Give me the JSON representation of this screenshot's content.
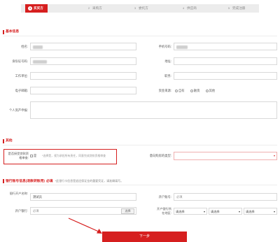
{
  "steps": [
    {
      "num": "1",
      "label": "买买方"
    },
    {
      "num": "2",
      "label": "采购方"
    },
    {
      "num": "3",
      "label": "委托方"
    },
    {
      "num": "4",
      "label": "供应商"
    },
    {
      "num": "5",
      "label": "完成注册"
    }
  ],
  "basic": {
    "title": "基本信息",
    "name_label": "姓名:",
    "phone_label": "手机号码:",
    "idcard_label": "身份证号码:",
    "address_label": "地址:",
    "workplace_label": "工作单位:",
    "position_label": "职务:",
    "email_label": "电子邮箱:",
    "funds_label": "资金来源:",
    "funds_options": [
      "自有",
      "融资",
      "其他"
    ],
    "assets_label": "个人资产申报:"
  },
  "other": {
    "title": "其他",
    "qualification_label": "是否接受贷款资格审查:",
    "checkbox_label": "是",
    "hint": "*选择是，视为承担所有责任，同意完成贷款资格审查",
    "intent_label": "意向购房的类型:"
  },
  "bank": {
    "title": "银行账号信息(退款转账用)",
    "required": "必填",
    "note": "*此银行卡信息是退还保证金的重要凭证，请准确填写。",
    "holder_label": "银行开户名称:",
    "holder_value": "测试员",
    "account_label": "开户账号:",
    "account_value": "必填",
    "bank_label": "开户银行:",
    "bank_value": "必填",
    "select_button": "选择",
    "branch_label": "开户银行所在地区:",
    "selects": [
      "请选择",
      "请选择",
      "请选择"
    ]
  },
  "actions": {
    "next": "下一步"
  },
  "colors": {
    "accent": "#d61f1f"
  }
}
